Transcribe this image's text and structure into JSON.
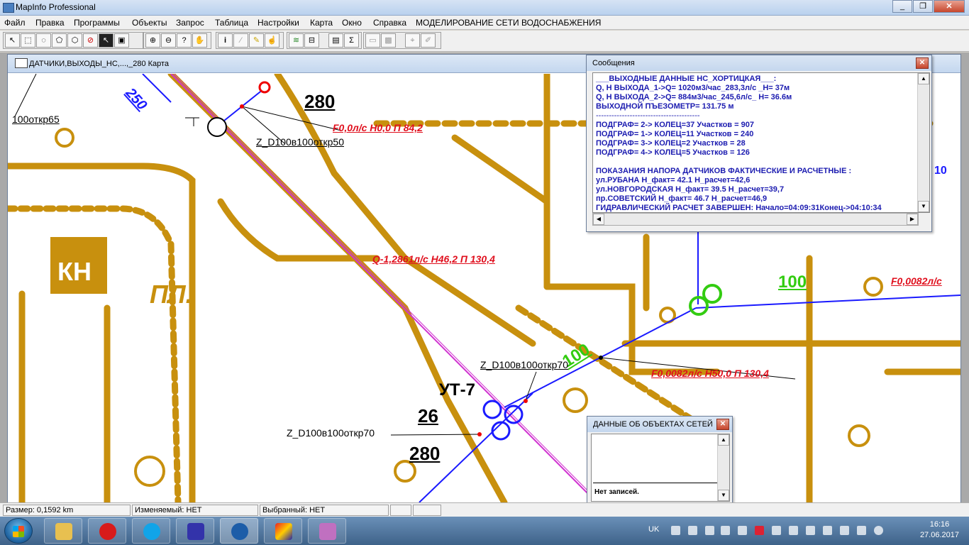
{
  "app": {
    "title": "MapInfo Professional"
  },
  "menu": [
    "Файл",
    "Правка",
    "Программы",
    "Объекты",
    "Запрос",
    "Таблица",
    "Настройки",
    "Карта",
    "Окно",
    "Справка",
    "МОДЕЛИРОВАНИЕ СЕТИ ВОДОСНАБЖЕНИЯ"
  ],
  "map_window": {
    "title": "ДАТЧИКИ,ВЫХОДЫ_НС,...,_280 Карта",
    "labels": {
      "otkr65": "100откр65",
      "n250": "250",
      "n280_top": "280",
      "z_d100_otkr50": "Z_D100в100откр50",
      "f00_h00": "F0,0л/с  H0,0  П  84,2",
      "q_h462": "Q-1,2861л/с  H46,2  П  130,4",
      "n100_green_right": "100",
      "f0082_right": "F0,0082л/с",
      "n100_green_diag": "100",
      "z_d100_otkr70_a": "Z_D100в100откр70",
      "f0082_h500": "F0,0082л/с  H50,0  П  130,4",
      "ut7": "УТ-7",
      "n26": "26",
      "z_d100_otkr70_b": "Z_D100в100откр70",
      "n280_bottom": "280",
      "kn": "КН",
      "pl": "ПЛ.",
      "edge_10": "10"
    }
  },
  "messages_window": {
    "title": "Сообщения",
    "lines": [
      "___ВЫХОДНЫЕ ДАННЫЕ НС_ХОРТИЦКАЯ___:",
      "Q, H ВЫХОДА_1->Q= 1020м3/час_283,3л/с _H= 37м",
      "Q, H ВЫХОДА_2->Q= 884м3/час_245,6л/с_ H= 36.6м",
      "ВЫХОДНОЙ ПЪЕЗОМЕТР= 131.75 м",
      "----------------------------------------",
      "ПОДГРАФ= 2-> КОЛЕЦ=37 Участков = 907",
      "ПОДГРАФ= 1-> КОЛЕЦ=11 Участков = 240",
      "ПОДГРАФ= 3-> КОЛЕЦ=2 Участков = 28",
      "ПОДГРАФ= 4-> КОЛЕЦ=5 Участков = 126",
      "",
      "ПОКАЗАНИЯ НАПОРА ДАТЧИКОВ ФАКТИЧЕСКИЕ И РАСЧЕТНЫЕ :",
      " ул.РУБАНА              H_факт= 42.1 H_расчет=42,6",
      " ул.НОВГОРОДСКАЯ H_факт= 39.5 H_расчет=39,7",
      " пр.СОВЕТСКИЙ         H_факт= 46.7 H_расчет=46,9",
      "ГИДРАВЛИЧЕСКИЙ РАСЧЕТ ЗАВЕРШЕН: Начало=04:09:31Конец->04:10:34"
    ]
  },
  "data_window": {
    "title": "ДАННЫЕ ОБ ОБЪЕКТАХ СЕТЕЙ",
    "empty_text": "Нет записей."
  },
  "status": {
    "size": "Размер: 0,1592 km",
    "editable": "Изменяемый: НЕТ",
    "selected": "Выбранный: НЕТ"
  },
  "taskbar": {
    "lang": "UK",
    "time": "16:16",
    "date": "27.06.2017"
  },
  "colors": {
    "map_ochre": "#c8900e",
    "label_red": "#e0101e",
    "label_green": "#33cc11",
    "pipe_blue": "#1a1aff",
    "message_blue": "#1b1bb0",
    "rail_magenta": "#d030d0"
  }
}
